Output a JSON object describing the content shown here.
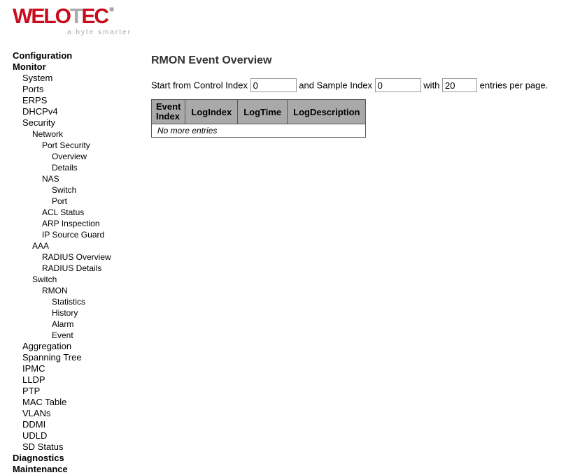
{
  "logo": {
    "main_pre": "WELO",
    "main_t": "T",
    "main_post": "EC",
    "tagline": "a byte smarter"
  },
  "nav": {
    "configuration": "Configuration",
    "monitor": "Monitor",
    "system": "System",
    "ports": "Ports",
    "erps": "ERPS",
    "dhcpv4": "DHCPv4",
    "security": "Security",
    "network": "Network",
    "port_security": "Port Security",
    "overview": "Overview",
    "details": "Details",
    "nas": "NAS",
    "switch": "Switch",
    "port": "Port",
    "acl_status": "ACL Status",
    "arp_inspection": "ARP Inspection",
    "ip_source_guard": "IP Source Guard",
    "aaa": "AAA",
    "radius_overview": "RADIUS Overview",
    "radius_details": "RADIUS Details",
    "switch_grp": "Switch",
    "rmon": "RMON",
    "statistics": "Statistics",
    "history": "History",
    "alarm": "Alarm",
    "event": "Event",
    "aggregation": "Aggregation",
    "spanning_tree": "Spanning Tree",
    "ipmc": "IPMC",
    "lldp": "LLDP",
    "ptp": "PTP",
    "mac_table": "MAC Table",
    "vlans": "VLANs",
    "ddmi": "DDMI",
    "udld": "UDLD",
    "sd_status": "SD Status",
    "diagnostics": "Diagnostics",
    "maintenance": "Maintenance"
  },
  "page": {
    "title": "RMON Event Overview",
    "start_from_label": "Start from Control Index",
    "and_sample_label": "and Sample Index",
    "with_label": "with",
    "entries_label": "entries per page.",
    "control_index": "0",
    "sample_index": "0",
    "entries_per_page": "20"
  },
  "table": {
    "headers": {
      "event_index_1": "Event",
      "event_index_2": "Index",
      "log_index": "LogIndex",
      "log_time": "LogTime",
      "log_description": "LogDescription"
    },
    "empty_msg": "No more entries"
  }
}
